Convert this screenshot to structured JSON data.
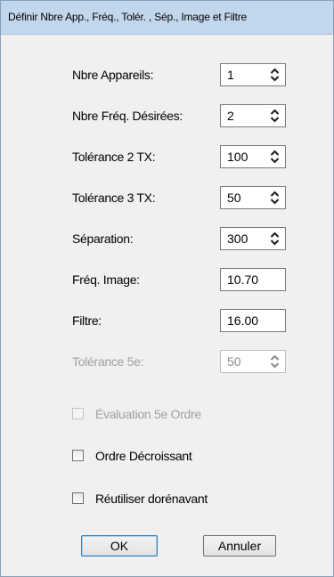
{
  "window": {
    "title": "Définir Nbre App.,  Fréq., Tolér. , Sép., Image et Filtre"
  },
  "fields": {
    "nbre_appareils": {
      "label": "Nbre Appareils:",
      "value": "1"
    },
    "nbre_freq": {
      "label": "Nbre Fréq. Désirées:",
      "value": "2"
    },
    "tol2": {
      "label": "Tolérance 2 TX:",
      "value": "100"
    },
    "tol3": {
      "label": "Tolérance 3 TX:",
      "value": "50"
    },
    "separation": {
      "label": "Séparation:",
      "value": "300"
    },
    "freq_image": {
      "label": "Fréq. Image:",
      "value": "10.70"
    },
    "filtre": {
      "label": "Filtre:",
      "value": "16.00"
    },
    "tol5": {
      "label": "Tolérance 5e:",
      "value": "50"
    }
  },
  "checkboxes": {
    "eval5": {
      "label": "Évaluation 5e Ordre",
      "checked": false,
      "enabled": false
    },
    "ordre_decr": {
      "label": "Ordre Décroissant",
      "checked": false,
      "enabled": true
    },
    "reutiliser": {
      "label": "Réutiliser dorénavant",
      "checked": false,
      "enabled": true
    }
  },
  "buttons": {
    "ok": "OK",
    "annuler": "Annuler"
  },
  "icons": {
    "spin_arrows": "up-down-chevron-icon"
  }
}
